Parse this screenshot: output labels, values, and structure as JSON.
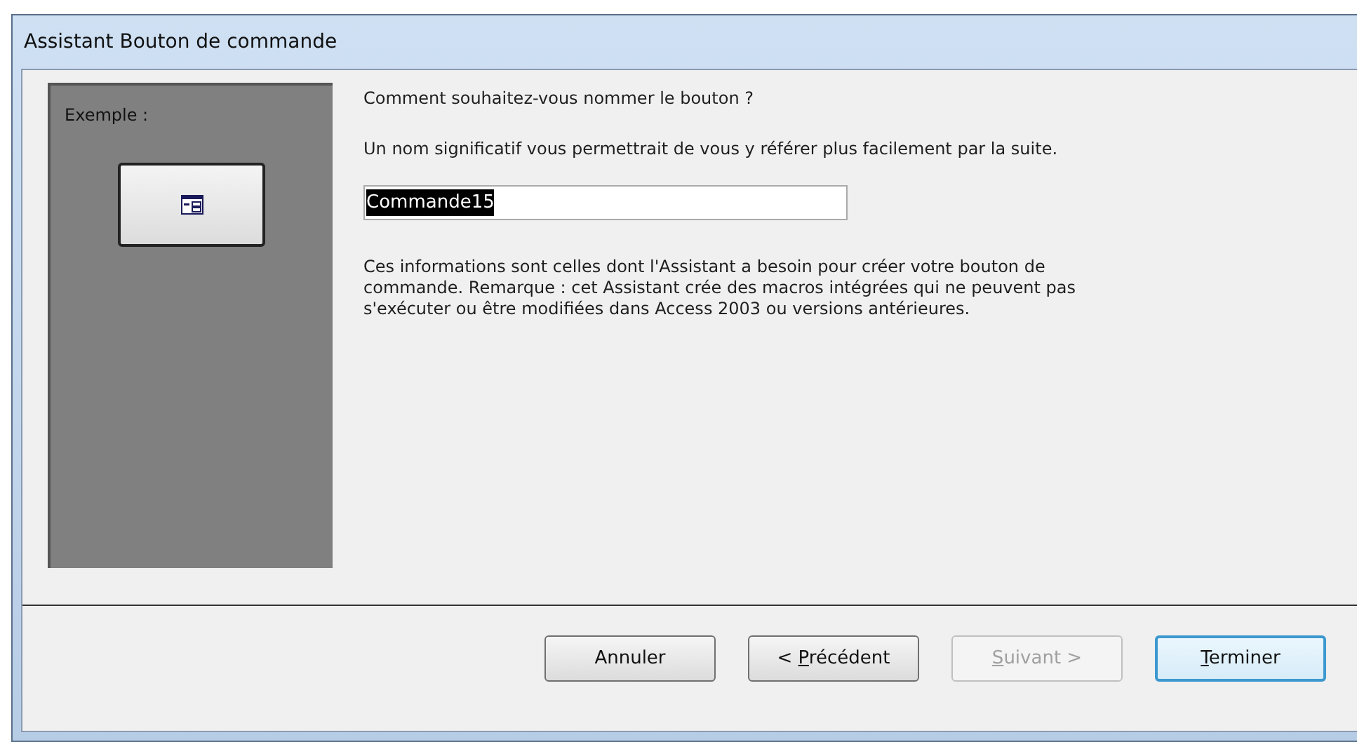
{
  "window": {
    "title": "Assistant Bouton de commande"
  },
  "example": {
    "label": "Exemple :"
  },
  "question": "Comment souhaitez-vous nommer le bouton ?",
  "hint": "Un nom significatif vous permettrait de vous y référer plus facilement par la suite.",
  "name_field": {
    "value": "Commande15",
    "selected": true
  },
  "info": "Ces informations sont celles dont l'Assistant a besoin pour créer votre bouton de commande. Remarque : cet Assistant crée des macros intégrées qui ne peuvent pas s'exécuter ou être modifiées dans Access 2003 ou versions antérieures.",
  "buttons": [
    {
      "before": "Annuler",
      "disabled": false,
      "default": false
    },
    {
      "before": "< ",
      "key": "P",
      "after": "récédent",
      "disabled": false,
      "default": false
    },
    {
      "key": "S",
      "after": "uivant >",
      "disabled": true,
      "default": false
    },
    {
      "key": "T",
      "after": "erminer",
      "disabled": false,
      "default": true
    }
  ]
}
